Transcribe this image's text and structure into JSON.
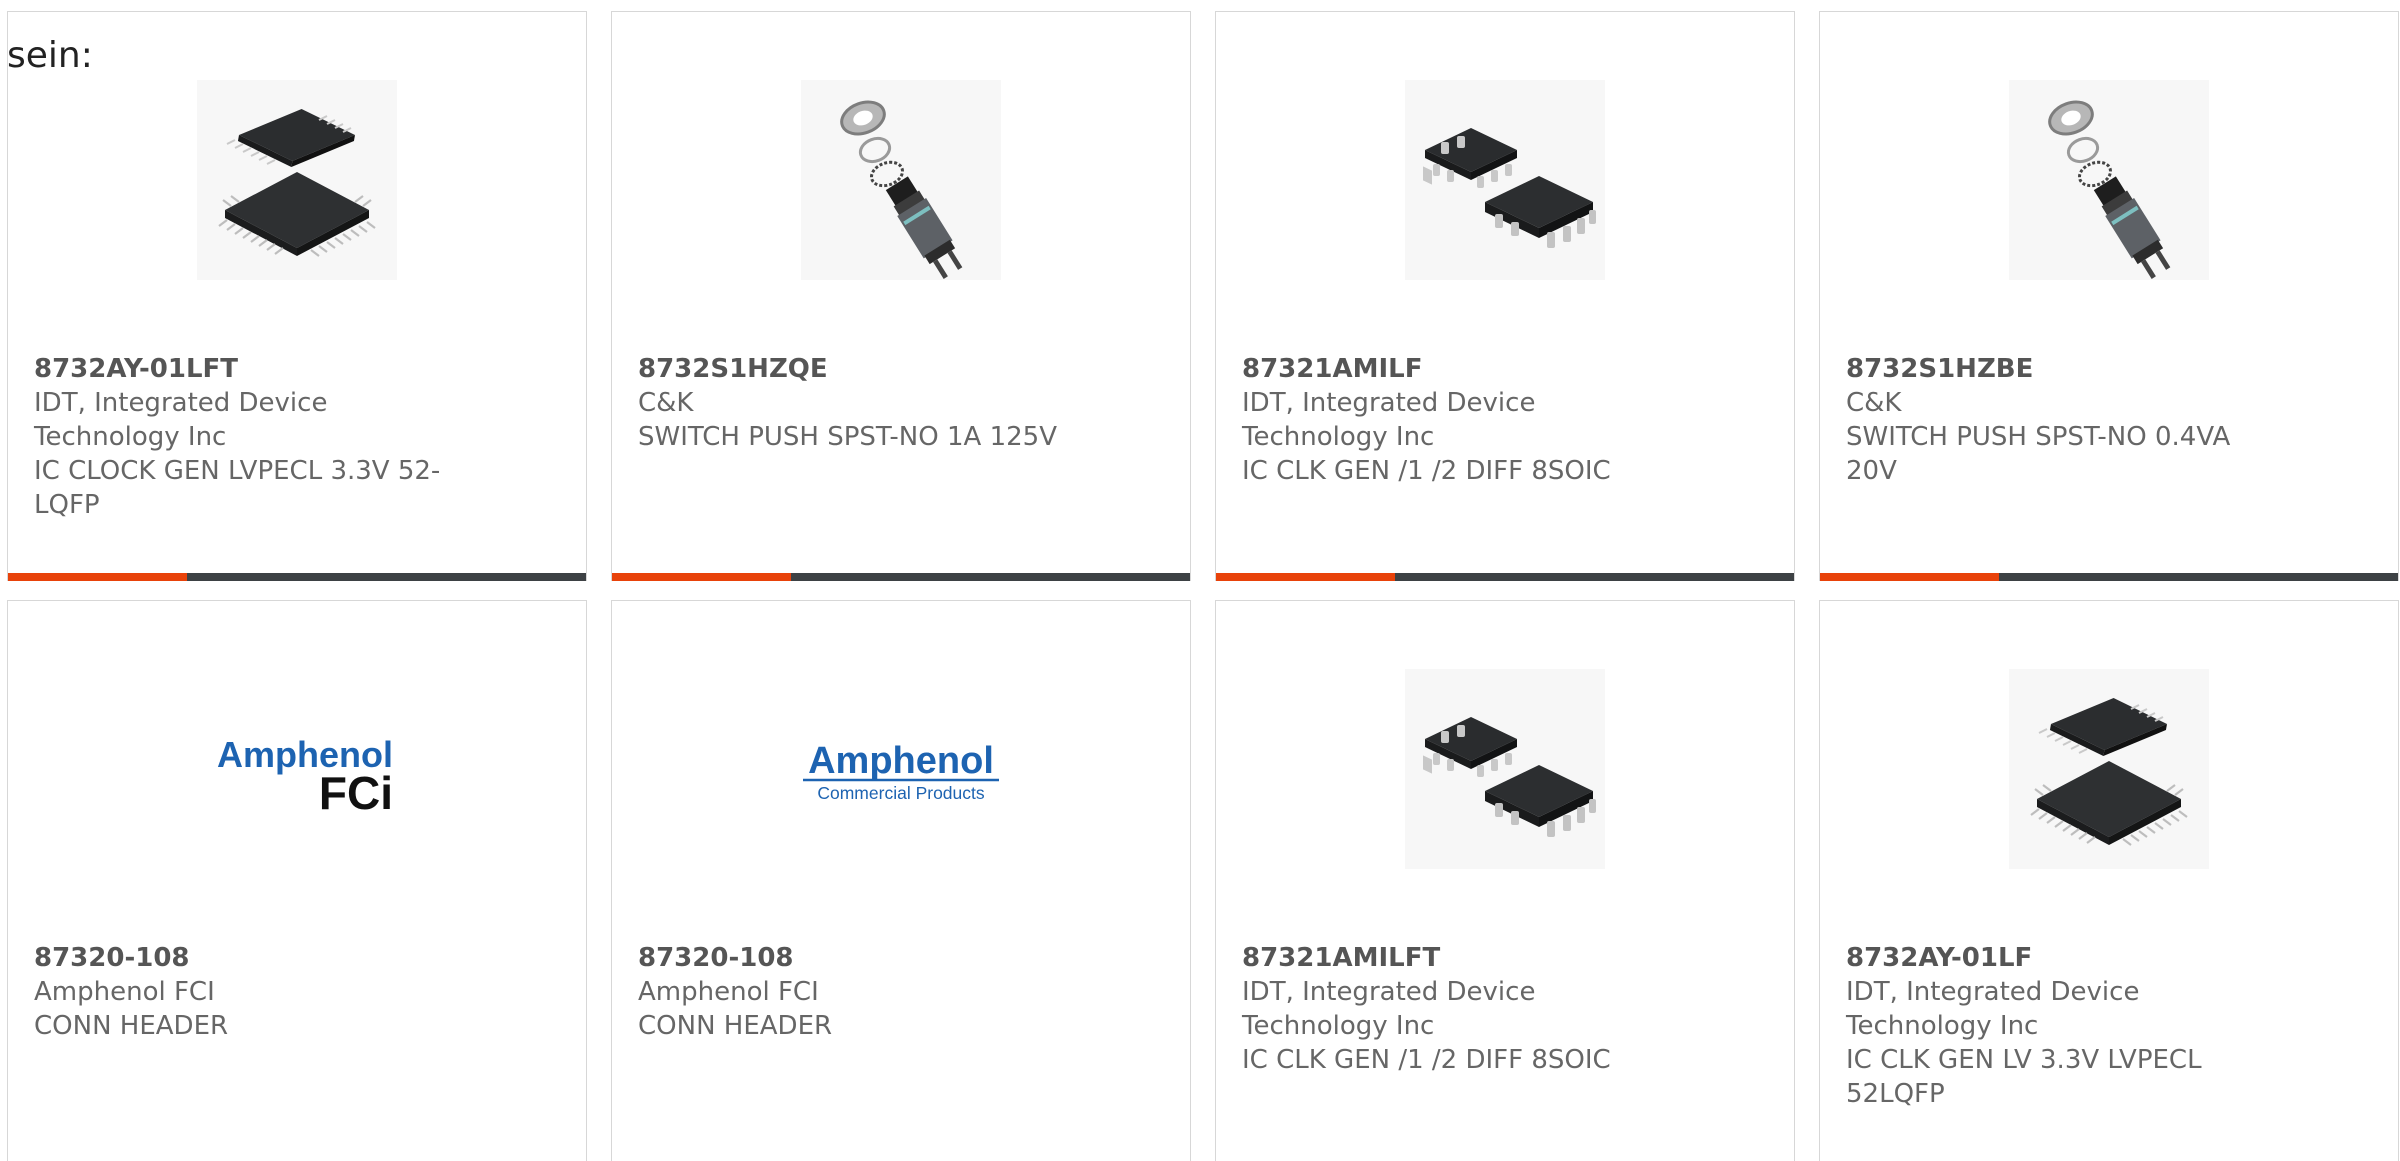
{
  "intro_text": "sein:",
  "colors": {
    "accent": "#e8420a",
    "bar_dark": "#3d4144",
    "amphenol_blue": "#1d63b1"
  },
  "products": [
    {
      "part_number": "8732AY-01LFT",
      "manufacturer_lines": [
        "IDT, Integrated Device",
        "Technology Inc"
      ],
      "description_lines": [
        "IC CLOCK GEN LVPECL 3.3V 52-",
        "LQFP"
      ],
      "image": "lqfp-chip-icon",
      "progress": 0.31
    },
    {
      "part_number": "8732S1HZQE",
      "manufacturer_lines": [
        "C&K"
      ],
      "description_lines": [
        "SWITCH PUSH SPST-NO 1A 125V"
      ],
      "image": "push-switch-icon",
      "progress": 0.31
    },
    {
      "part_number": "87321AMILF",
      "manufacturer_lines": [
        "IDT, Integrated Device",
        "Technology Inc"
      ],
      "description_lines": [
        "IC CLK GEN /1 /2 DIFF 8SOIC"
      ],
      "image": "soic-chip-icon",
      "progress": 0.31
    },
    {
      "part_number": "8732S1HZBE",
      "manufacturer_lines": [
        "C&K"
      ],
      "description_lines": [
        "SWITCH PUSH SPST-NO 0.4VA",
        "20V"
      ],
      "image": "push-switch-icon",
      "progress": 0.31
    },
    {
      "part_number": "87320-108",
      "manufacturer_lines": [
        "Amphenol FCI"
      ],
      "description_lines": [
        "CONN HEADER"
      ],
      "image": "amphenol-fci-logo",
      "logo_text": [
        "Amphenol",
        "FCi"
      ]
    },
    {
      "part_number": "87320-108",
      "manufacturer_lines": [
        "Amphenol FCI"
      ],
      "description_lines": [
        "CONN HEADER"
      ],
      "image": "amphenol-commercial-logo",
      "logo_text": [
        "Amphenol",
        "Commercial Products"
      ]
    },
    {
      "part_number": "87321AMILFT",
      "manufacturer_lines": [
        "IDT, Integrated Device",
        "Technology Inc"
      ],
      "description_lines": [
        "IC CLK GEN /1 /2 DIFF 8SOIC"
      ],
      "image": "soic-chip-icon"
    },
    {
      "part_number": "8732AY-01LF",
      "manufacturer_lines": [
        "IDT, Integrated Device",
        "Technology Inc"
      ],
      "description_lines": [
        "IC CLK GEN LV 3.3V LVPECL",
        "52LQFP"
      ],
      "image": "lqfp-chip-icon"
    }
  ]
}
